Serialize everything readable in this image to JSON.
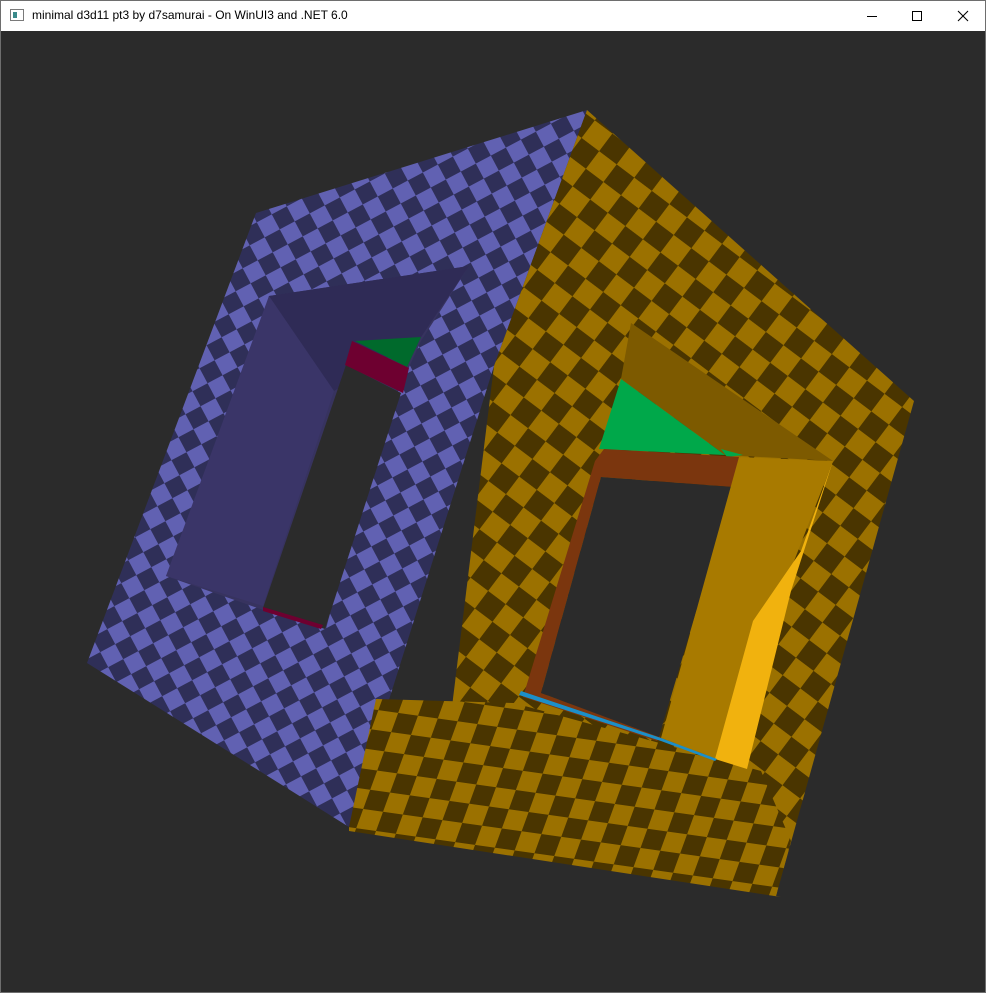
{
  "window": {
    "title": "minimal d3d11 pt3 by d7samurai - On WinUI3 and .NET 6.0",
    "icon": "app-window-icon",
    "buttons": {
      "minimize": "minimize-icon",
      "maximize": "maximize-icon",
      "close": "close-icon"
    }
  },
  "scene": {
    "background": "#2b2b2b",
    "object": "rotating checkered cube with square tunnels",
    "faces": {
      "blue_checker_light": "#6161b2",
      "blue_checker_dark": "#2f2f58",
      "orange_checker_light": "#9b7100",
      "orange_checker_dark": "#4a3500",
      "blue_tunnel_wall": "#37335f",
      "orange_tunnel_wall": "#a87a00",
      "orange_tunnel_bright": "#f1b20e",
      "green_inner": "#00a84a",
      "dark_green_inner": "#006a2c",
      "maroon_inner": "#6e0030",
      "brown_inner": "#7b360e",
      "cyan_inner": "#1c8fc8"
    }
  }
}
